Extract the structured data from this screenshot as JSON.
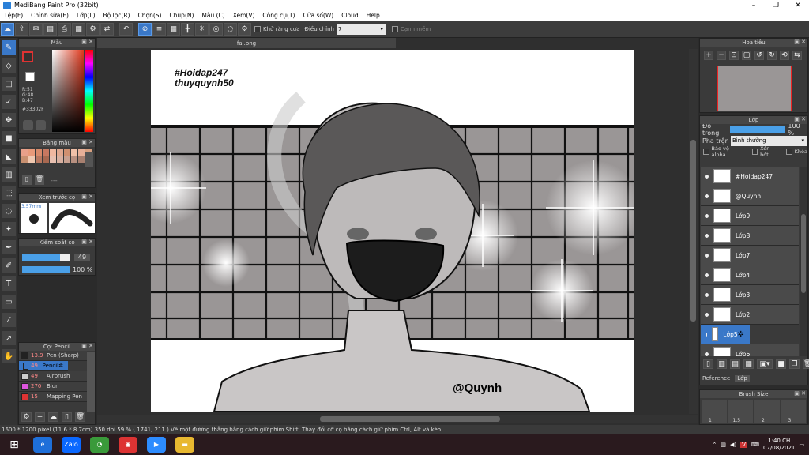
{
  "window": {
    "title": "MediBang Paint Pro (32bit)",
    "min": "–",
    "max": "❐",
    "close": "✕"
  },
  "menu": [
    "Tệp(F)",
    "Chỉnh sửa(E)",
    "Lớp(L)",
    "Bộ lọc(R)",
    "Chọn(S)",
    "Chụp(N)",
    "Màu (C)",
    "Xem(V)",
    "Công cụ(T)",
    "Cửa sổ(W)",
    "Cloud",
    "Help"
  ],
  "toolbar": {
    "antialias_label": "Khử răng cưa",
    "correction_label": "Điều chỉnh",
    "correction_value": "7",
    "snap_label": "Cạnh mềm"
  },
  "color_panel": {
    "title": "Màu",
    "r": "R:51",
    "g": "G:48",
    "b": "B:47",
    "hex": "#33302F"
  },
  "palette_panel": {
    "title": "Bảng màu",
    "extra": "---"
  },
  "brush_preview": {
    "title": "Xem trước cọ",
    "size": "3.57mm"
  },
  "control_panel": {
    "title": "Kiểm soát cọ",
    "size_value": "49",
    "opacity_value": "100 %"
  },
  "brush_panel": {
    "title": "Cọ: Pencil",
    "items": [
      {
        "size": "13.9",
        "name": "Pen (Sharp)",
        "color": "#222222"
      },
      {
        "size": "49",
        "name": "Pencil",
        "color": "#3a78c8"
      },
      {
        "size": "49",
        "name": "Airbrush",
        "color": "#cccccc"
      },
      {
        "size": "270",
        "name": "Blur",
        "color": "#dd55dd"
      },
      {
        "size": "15",
        "name": "Mapping Pen",
        "color": "#dd3333"
      }
    ]
  },
  "document": {
    "tab_name": "fai.png",
    "caption_line1": "#Hoidap247",
    "caption_line2": "thuyquynh50",
    "signature": "@Quynh"
  },
  "navigator": {
    "title": "Hoa tiêu"
  },
  "layers_panel": {
    "title": "Lớp",
    "opacity_label": "Độ trong",
    "opacity_value": "100 %",
    "blend_label": "Pha trộn",
    "blend_value": "Bình thường",
    "protect_alpha": "Bảo vệ alpha",
    "clipping": "Xén bớt",
    "lock": "Khóa",
    "layers": [
      "#Hoidap247",
      "@Quynh",
      "Lớp9",
      "Lớp8",
      "Lớp7",
      "Lớp4",
      "Lớp3",
      "Lớp2",
      "Lớp5",
      "Lớp6"
    ],
    "selected": "Lớp5",
    "reference_label": "Reference",
    "layer_tab": "Lớp"
  },
  "brush_size_panel": {
    "title": "Brush Size",
    "labels": [
      "1",
      "1.5",
      "2",
      "3"
    ]
  },
  "status": {
    "text": "1600 * 1200 pixel  (11.6 * 8.7cm)  350 dpi  59 %  ( 1741, 211 )  Vẽ một đường thẳng bằng cách giữ phím Shift, Thay đổi cỡ cọ bằng cách giữ phím Ctrl, Alt và kéo"
  },
  "taskbar": {
    "time": "1:40 CH",
    "date": "07/08/2021",
    "zalo": "Zalo"
  }
}
